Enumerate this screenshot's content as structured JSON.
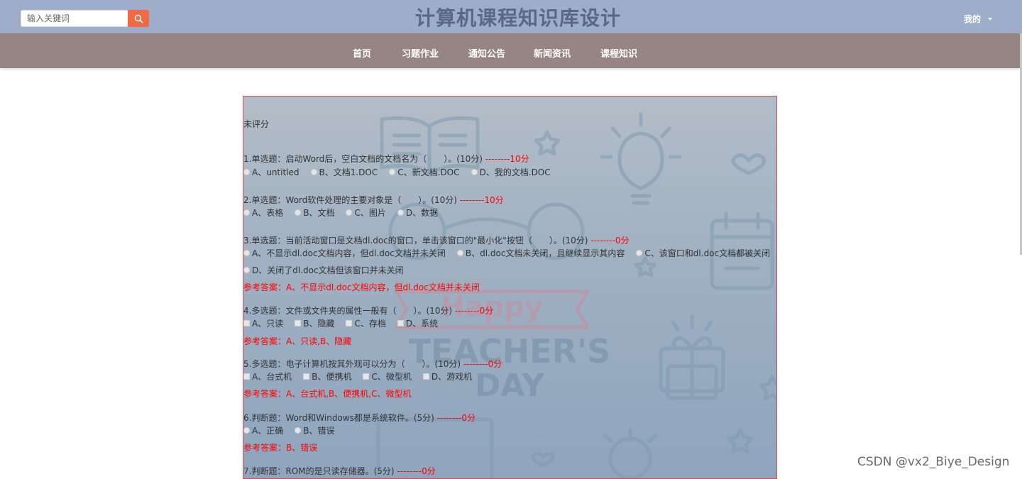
{
  "header": {
    "search_placeholder": "输入关键词",
    "site_title": "计算机课程知识库设计",
    "user_menu_label": "我的"
  },
  "nav": {
    "items": [
      {
        "label": "首页"
      },
      {
        "label": "习题作业"
      },
      {
        "label": "通知公告"
      },
      {
        "label": "新闻资讯"
      },
      {
        "label": "课程知识"
      }
    ]
  },
  "exam": {
    "status": "未评分",
    "questions": [
      {
        "title": "1.单选题：启动Word后，空白文档的文档名为（　　）。(10分)",
        "score": "--------10分",
        "type": "radio",
        "options": [
          {
            "label": "A、untitled"
          },
          {
            "label": "B、文档1.DOC"
          },
          {
            "label": "C、新文档.DOC"
          },
          {
            "label": "D、我的文档.DOC"
          }
        ]
      },
      {
        "title": "2.单选题：Word软件处理的主要对象是（　　）。(10分)",
        "score": "--------10分",
        "type": "radio",
        "options": [
          {
            "label": "A、表格"
          },
          {
            "label": "B、文档"
          },
          {
            "label": "C、图片"
          },
          {
            "label": "D、数据"
          }
        ]
      },
      {
        "title": "3.单选题：当前活动窗口是文档dl.doc的窗口，单击该窗口的\"最小化\"按钮（　　）。(10分)",
        "score": "--------0分",
        "type": "radio",
        "options": [
          {
            "label": "A、不显示dl.doc文档内容，但dl.doc文档并未关闭"
          },
          {
            "label": "B、dl.doc文档未关闭，且继续显示其内容"
          },
          {
            "label": "C、该窗口和dl.doc文档都被关闭"
          }
        ],
        "options_row2": [
          {
            "label": "D、关闭了dl.doc文档但该窗口并未关闭"
          }
        ],
        "reference": "参考答案：A、不显示dl.doc文档内容，但dl.doc文档并未关闭"
      },
      {
        "title": "4.多选题：文件或文件夹的属性一般有（　　）。(10分)",
        "score": "--------0分",
        "type": "check",
        "options": [
          {
            "label": "A、只读"
          },
          {
            "label": "B、隐藏"
          },
          {
            "label": "C、存档"
          },
          {
            "label": "D、系统"
          }
        ],
        "reference": "参考答案：A、只读,B、隐藏"
      },
      {
        "title": "5.多选题：电子计算机按其外观可以分为（　　）。(10分)",
        "score": "--------0分",
        "type": "check",
        "options": [
          {
            "label": "A、台式机"
          },
          {
            "label": "B、便携机"
          },
          {
            "label": "C、微型机"
          },
          {
            "label": "D、游戏机"
          }
        ],
        "reference": "参考答案：A、台式机,B、便携机,C、微型机"
      },
      {
        "title": "6.判断题：Word和Windows都是系统软件。(5分)",
        "score": "--------0分",
        "type": "radio",
        "options": [
          {
            "label": "A、正确"
          },
          {
            "label": "B、错误"
          }
        ],
        "reference": "参考答案：B、错误"
      },
      {
        "title": "7.判断题：ROM的是只读存储器。(5分)",
        "score": "--------0分"
      }
    ]
  },
  "footer": {
    "watermark_text": "CSDN @vx2_Biye_Design"
  }
}
